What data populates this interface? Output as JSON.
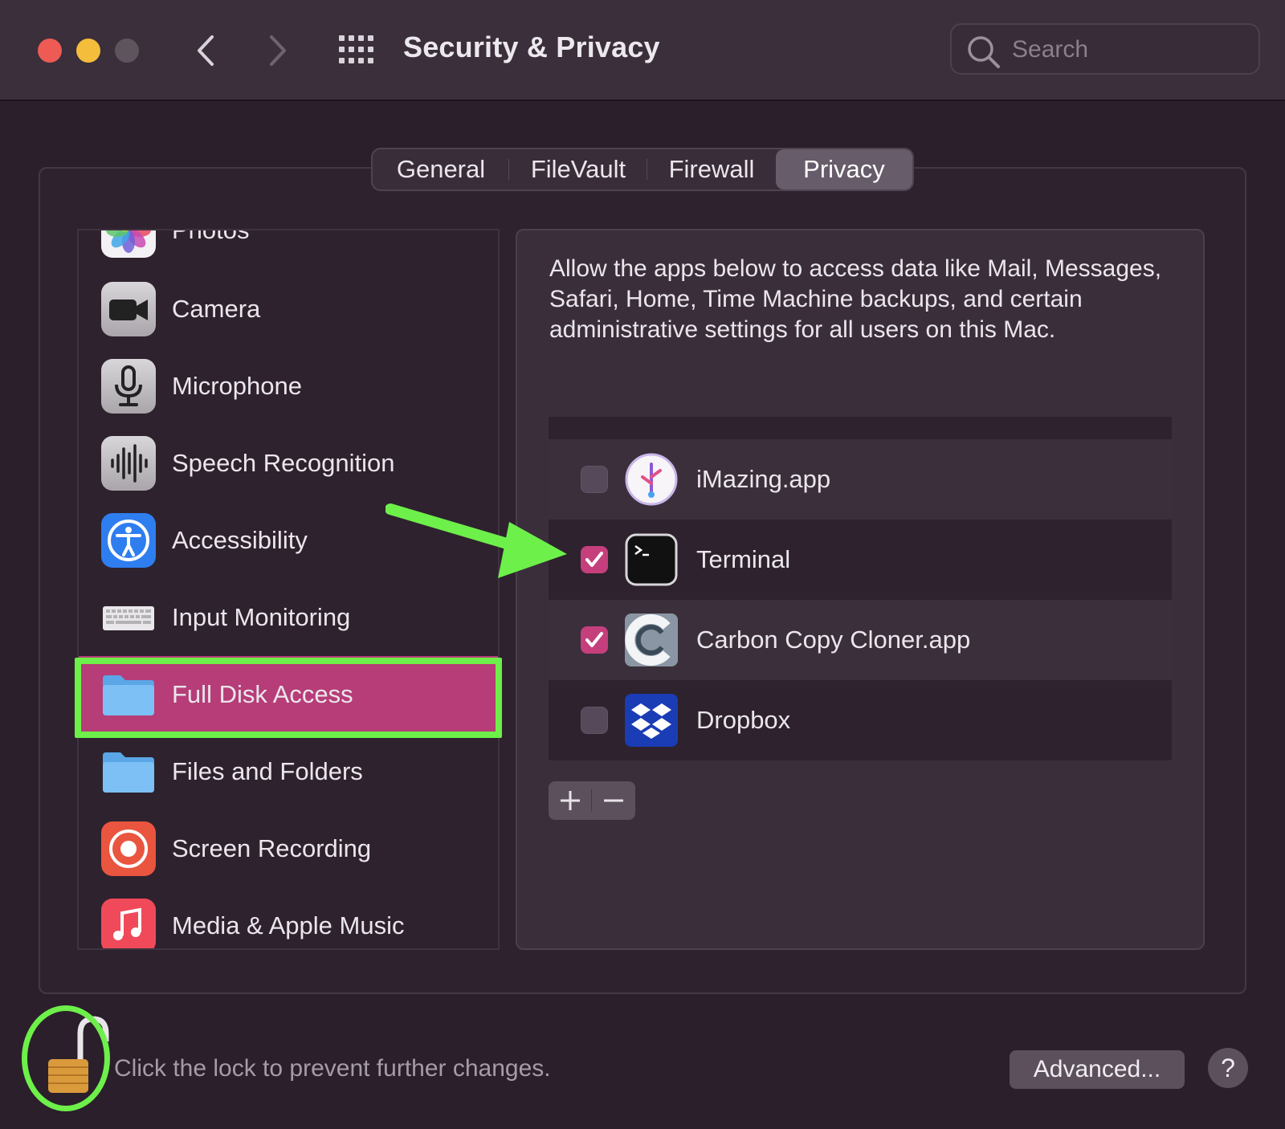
{
  "window": {
    "title": "Security & Privacy"
  },
  "search": {
    "placeholder": "Search"
  },
  "tabs": [
    {
      "label": "General"
    },
    {
      "label": "FileVault"
    },
    {
      "label": "Firewall"
    },
    {
      "label": "Privacy",
      "active": true
    }
  ],
  "sidebar": {
    "items": [
      {
        "label": "Photos",
        "icon": "photos-icon"
      },
      {
        "label": "Camera",
        "icon": "camera-icon"
      },
      {
        "label": "Microphone",
        "icon": "microphone-icon"
      },
      {
        "label": "Speech Recognition",
        "icon": "waveform-icon"
      },
      {
        "label": "Accessibility",
        "icon": "accessibility-icon"
      },
      {
        "label": "Input Monitoring",
        "icon": "keyboard-icon"
      },
      {
        "label": "Full Disk Access",
        "icon": "folder-icon",
        "selected": true
      },
      {
        "label": "Files and Folders",
        "icon": "folder-icon"
      },
      {
        "label": "Screen Recording",
        "icon": "screen-recording-icon"
      },
      {
        "label": "Media & Apple Music",
        "icon": "music-icon"
      }
    ]
  },
  "main": {
    "description": "Allow the apps below to access data like Mail, Messages, Safari, Home, Time Machine backups, and certain administrative settings for all users on this Mac.",
    "apps": [
      {
        "label": "iMazing.app",
        "checked": false,
        "icon": "imazing-icon"
      },
      {
        "label": "Terminal",
        "checked": true,
        "icon": "terminal-icon"
      },
      {
        "label": "Carbon Copy Cloner.app",
        "checked": true,
        "icon": "carbon-copy-cloner-icon"
      },
      {
        "label": "Dropbox",
        "checked": false,
        "icon": "dropbox-icon"
      }
    ]
  },
  "footer": {
    "lock_text": "Click the lock to prevent further changes.",
    "advanced_label": "Advanced...",
    "help_label": "?"
  },
  "colors": {
    "accent": "#b63d77",
    "checkbox_on": "#c53f7d",
    "annotation_green": "#6df04a"
  }
}
